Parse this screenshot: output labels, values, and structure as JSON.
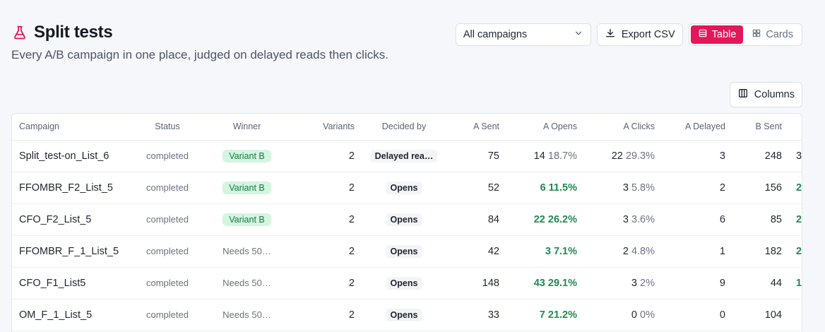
{
  "header": {
    "title": "Split tests",
    "subtitle": "Every A/B campaign in one place, judged on delayed reads then clicks."
  },
  "toolbar": {
    "campaign_filter": "All campaigns",
    "export_label": "Export CSV",
    "view_table": "Table",
    "view_cards": "Cards",
    "columns_label": "Columns"
  },
  "colors": {
    "accent": "#e3175a",
    "success": "#1f8a51"
  },
  "table": {
    "headers": {
      "campaign": "Campaign",
      "status": "Status",
      "winner": "Winner",
      "variants": "Variants",
      "decided_by": "Decided by",
      "a_sent": "A Sent",
      "a_opens": "A Opens",
      "a_clicks": "A Clicks",
      "a_delayed": "A Delayed",
      "b_sent": "B Sent"
    },
    "rows": [
      {
        "campaign": "Split_test-on_List_6",
        "status": "completed",
        "winner": "Variant B",
        "variants": "2",
        "decided_by": "Delayed rea…",
        "a_sent": "75",
        "a_opens": "14",
        "a_opens_pct": "18.7%",
        "a_clicks": "22",
        "a_clicks_pct": "29.3%",
        "a_delayed": "3",
        "b_sent": "248",
        "b_opens": "3"
      },
      {
        "campaign": "FFOMBR_F2_List_5",
        "status": "completed",
        "winner": "Variant B",
        "variants": "2",
        "decided_by": "Opens",
        "a_sent": "52",
        "a_opens": "6",
        "a_opens_pct": "11.5%",
        "a_clicks": "3",
        "a_clicks_pct": "5.8%",
        "a_delayed": "2",
        "b_sent": "156",
        "b_opens": "2"
      },
      {
        "campaign": "CFO_F2_List_5",
        "status": "completed",
        "winner": "Variant B",
        "variants": "2",
        "decided_by": "Opens",
        "a_sent": "84",
        "a_opens": "22",
        "a_opens_pct": "26.2%",
        "a_clicks": "3",
        "a_clicks_pct": "3.6%",
        "a_delayed": "6",
        "b_sent": "85",
        "b_opens": "2"
      },
      {
        "campaign": "FFOMBR_F_1_List_5",
        "status": "completed",
        "winner": "Needs 50…",
        "variants": "2",
        "decided_by": "Opens",
        "a_sent": "42",
        "a_opens": "3",
        "a_opens_pct": "7.1%",
        "a_clicks": "2",
        "a_clicks_pct": "4.8%",
        "a_delayed": "1",
        "b_sent": "182",
        "b_opens": "2"
      },
      {
        "campaign": "CFO_F1_List5",
        "status": "completed",
        "winner": "Needs 50…",
        "variants": "2",
        "decided_by": "Opens",
        "a_sent": "148",
        "a_opens": "43",
        "a_opens_pct": "29.1%",
        "a_clicks": "3",
        "a_clicks_pct": "2%",
        "a_delayed": "9",
        "b_sent": "44",
        "b_opens": "1"
      },
      {
        "campaign": "OM_F_1_List_5",
        "status": "completed",
        "winner": "Needs 50…",
        "variants": "2",
        "decided_by": "Opens",
        "a_sent": "33",
        "a_opens": "7",
        "a_opens_pct": "21.2%",
        "a_clicks": "0",
        "a_clicks_pct": "0%",
        "a_delayed": "0",
        "b_sent": "104",
        "b_opens": ""
      }
    ]
  }
}
